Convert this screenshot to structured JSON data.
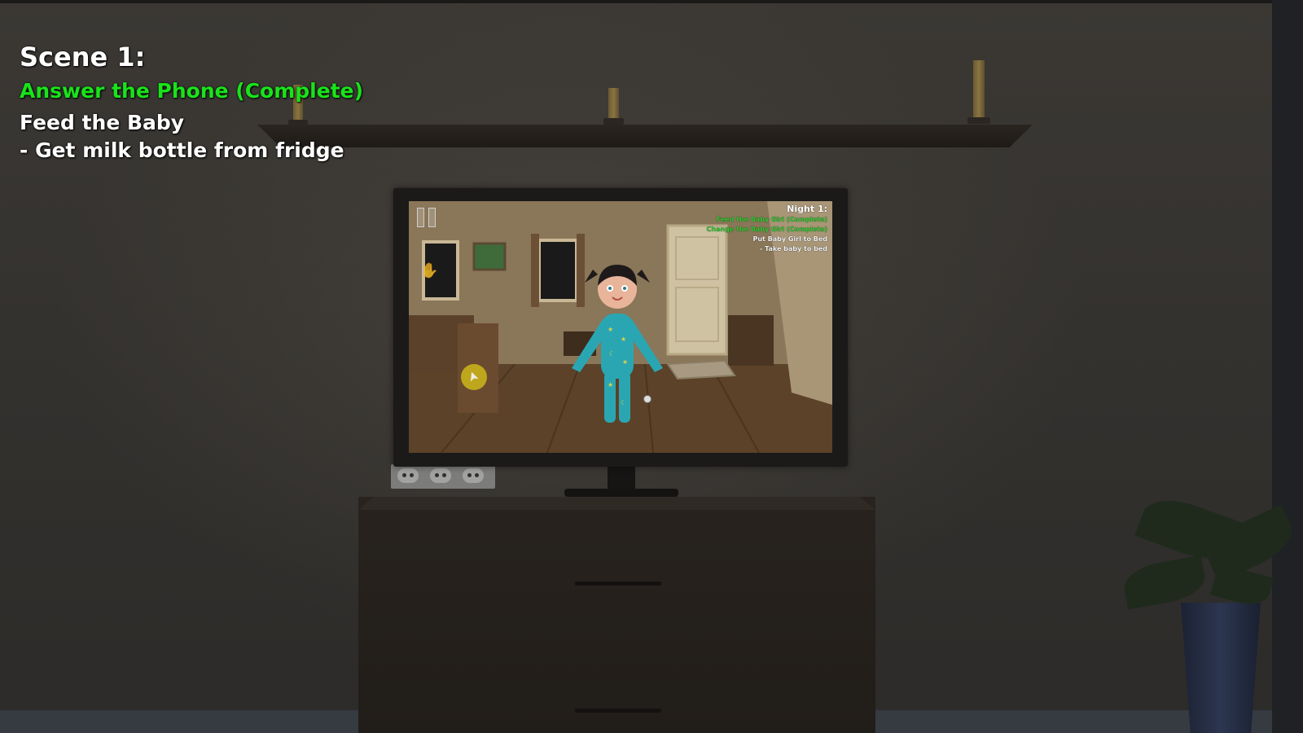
{
  "hud": {
    "title": "Scene 1:",
    "completed_objective": "Answer the Phone (Complete)",
    "current_objective": "Feed the Baby",
    "sub_objective": "- Get milk bottle from fridge"
  },
  "tv_game": {
    "title": "Night 1:",
    "objectives": [
      {
        "text": "Feed the Baby Girl (Complete)",
        "status": "complete"
      },
      {
        "text": "Change the Baby Girl (Complete)",
        "status": "complete"
      },
      {
        "text": "Put Baby Girl to Bed",
        "status": "current"
      },
      {
        "text": "- Take baby to bed",
        "status": "sub"
      }
    ]
  },
  "colors": {
    "complete": "#19e31a",
    "text": "#ffffff",
    "wall": "#3b3834"
  },
  "icons": [
    "pause-icon",
    "hand-icon",
    "cursor-icon",
    "crosshair-icon"
  ]
}
